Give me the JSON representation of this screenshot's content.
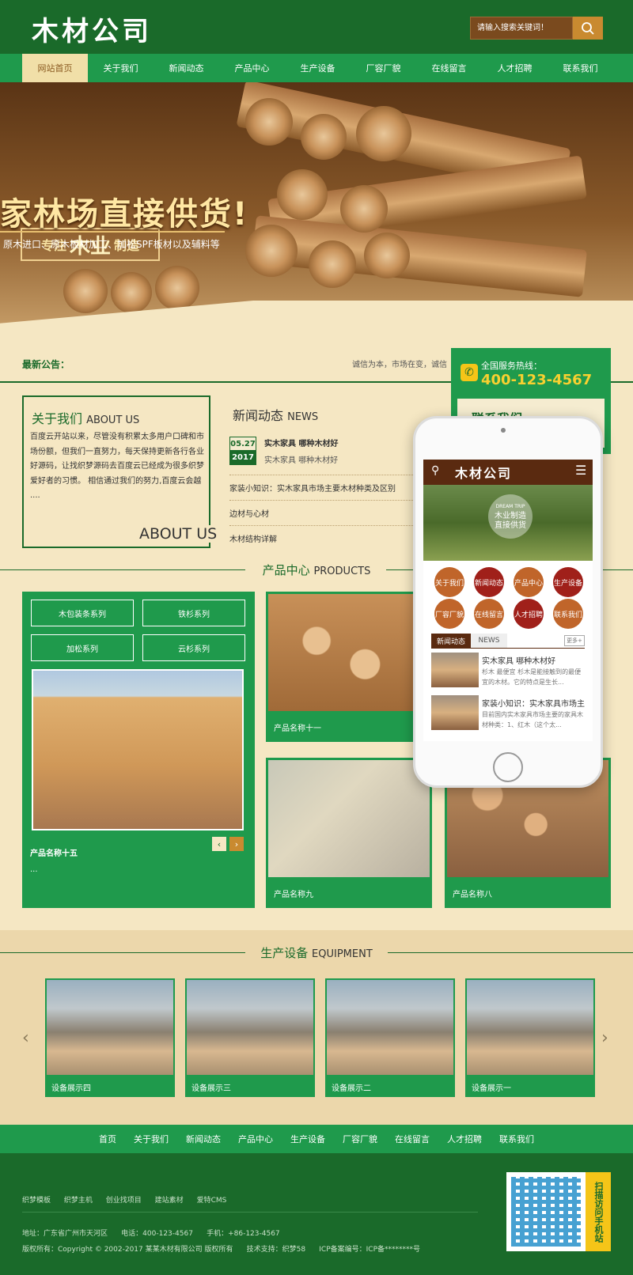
{
  "header": {
    "logo": "木材公司",
    "search_placeholder": "请输入搜索关键词！"
  },
  "nav": [
    "网站首页",
    "关于我们",
    "新闻动态",
    "产品中心",
    "生产设备",
    "厂容厂貌",
    "在线留言",
    "人才招聘",
    "联系我们"
  ],
  "banner": {
    "tag_prefix": "专注",
    "tag_big": "木业",
    "tag_suffix": "制造",
    "title": "家林场直接供货!",
    "subtitle": "原木进口、原木板材加工、加松SPF板材以及辅料等"
  },
  "notice": {
    "label": "最新公告：",
    "text": "诚信为本，市场在变，诚信"
  },
  "hotline": {
    "label": "全国服务热线：",
    "phone": "400-123-4567",
    "contact_title": "联系我们"
  },
  "about": {
    "title": "关于我们",
    "title_en": "ABOUT US",
    "text": "百度云开站以来，尽管没有积累太多用户口碑和市场份额，但我们一直努力，每天保持更新各行各业好源码，让找织梦源码去百度云已经成为很多织梦爱好者的习惯。 相信通过我们的努力,百度云会越 ....",
    "big_label": "ABOUT US"
  },
  "news": {
    "title": "新闻动态",
    "title_en": "NEWS",
    "date_day": "05.27",
    "date_year": "2017",
    "featured_title": "实木家具 哪种木材好",
    "featured_desc": "实木家具 哪种木材好",
    "items": [
      "家装小知识：实木家具市场主要木材种类及区别",
      "边材与心材",
      "木材结构详解"
    ]
  },
  "products": {
    "title": "产品中心",
    "title_en": "PRODUCTS",
    "categories": [
      "木包装条系列",
      "铁杉系列",
      "加松系列",
      "云杉系列"
    ],
    "main_name": "产品名称十五",
    "main_dots": "...",
    "prev": "‹",
    "next": "›",
    "cards": [
      "产品名称十一",
      "产品名称九",
      "产品名称八"
    ]
  },
  "equipment": {
    "title": "生产设备",
    "title_en": "EQUIPMENT",
    "items": [
      "设备展示四",
      "设备展示三",
      "设备展示二",
      "设备展示一"
    ]
  },
  "mobile": {
    "logo": "木材公司",
    "badge_top": "DREAM TRIP",
    "badge_line1": "木业制造",
    "badge_line2": "直接供货",
    "circles": [
      "关于我们",
      "新闻动态",
      "产品中心",
      "生产设备",
      "厂容厂貌",
      "在线留言",
      "人才招聘",
      "联系我们"
    ],
    "tab_active": "新闻动态",
    "tab_en": "NEWS",
    "more": "更多+",
    "news": [
      {
        "title": "实木家具 哪种木材好",
        "desc": "杉木 最便宜 杉木是能接触到的最便宜的木材。它的特点是生长..."
      },
      {
        "title": "家装小知识：实木家具市场主...",
        "desc": "目前国内实木家具市场主要的家具木材种类：1、红木（这个太..."
      }
    ]
  },
  "footer": {
    "nav": [
      "首页",
      "关于我们",
      "新闻动态",
      "产品中心",
      "生产设备",
      "厂容厂貌",
      "在线留言",
      "人才招聘",
      "联系我们"
    ],
    "links": [
      "织梦模板",
      "织梦主机",
      "创业找项目",
      "建站素材",
      "爱特CMS"
    ],
    "address": "地址：广东省广州市天河区      电话：400-123-4567      手机：+86-123-4567",
    "copyright": "版权所有：Copyright © 2002-2017 某某木材有限公司 版权所有      技术支持：织梦58      ICP备案编号：ICP备********号",
    "qr_label": "扫描访问手机站"
  }
}
